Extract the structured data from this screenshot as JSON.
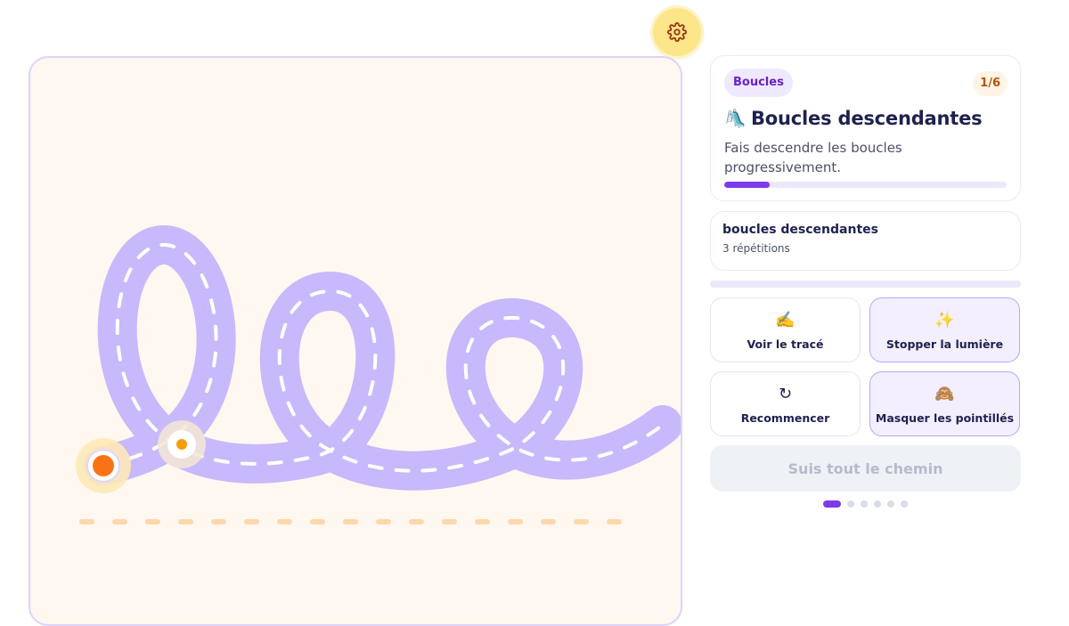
{
  "settings": {
    "icon": "gear-icon"
  },
  "lesson": {
    "category": "Boucles",
    "counter": "1/6",
    "emoji": "🛝",
    "title": "Boucles descendantes",
    "description": "Fais descendre les boucles progressivement.",
    "progress": 0.16
  },
  "pattern": {
    "name": "boucles descendantes",
    "repetitions": "3 répétitions"
  },
  "actions": [
    {
      "emoji": "✍️",
      "label": "Voir le tracé",
      "active": false
    },
    {
      "emoji": "✨",
      "label": "Stopper la lumière",
      "active": true
    },
    {
      "emoji": "↻",
      "label": "Recommencer",
      "active": false
    },
    {
      "emoji": "🙈",
      "label": "Masquer les pointillés",
      "active": true
    }
  ],
  "follow_button": "Suis tout le chemin",
  "pagination": {
    "count": 6,
    "current": 0
  },
  "colors": {
    "accent": "#7c3aed",
    "track": "#c7b9fb",
    "start_dot": "#f97316",
    "guide_dot": "#f59e0b",
    "baseline": "#fed7aa"
  }
}
